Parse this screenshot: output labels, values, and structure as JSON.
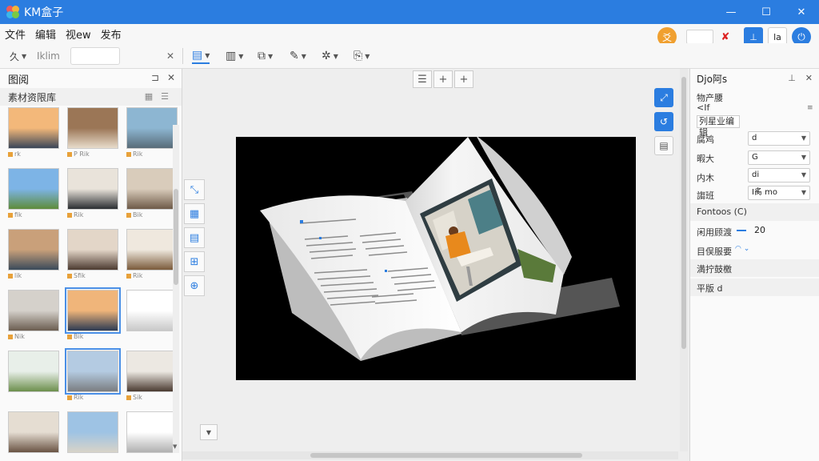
{
  "app": {
    "title": "KM盒子",
    "window_controls": [
      "—",
      "☐",
      "✕"
    ],
    "logo_colors": [
      "#f05a5a",
      "#f2b43a",
      "#3ab6ea",
      "#7ac943"
    ]
  },
  "menu": {
    "items": [
      "文件",
      "编辑",
      "视ew",
      "发布"
    ],
    "right": {
      "orange_btn": "爻",
      "input_value": "",
      "red_x": "✘",
      "blue_btn": "⊥",
      "la_btn": "la",
      "power_btn": "⏻"
    }
  },
  "toolbar": {
    "undo_label": "久",
    "klim_label": "Iklim",
    "field_value": "",
    "close_x": "✕",
    "groups": [
      {
        "icon": "page-icon",
        "glyph": "▤"
      },
      {
        "icon": "doc-icon",
        "glyph": "▥"
      },
      {
        "icon": "frame-icon",
        "glyph": "⧉"
      },
      {
        "icon": "edit-icon",
        "glyph": "✎"
      },
      {
        "icon": "effects-icon",
        "glyph": "✲"
      },
      {
        "icon": "export-icon",
        "glyph": "⎘"
      }
    ]
  },
  "left_panel": {
    "title": "图阅",
    "pin": "⊐",
    "close": "✕",
    "library_title": "素材资限库",
    "thumbs": [
      {
        "label": "rk",
        "style": "sunset"
      },
      {
        "label": "P Rik",
        "style": "interior"
      },
      {
        "label": "Rik",
        "style": "city"
      },
      {
        "label": "fik",
        "style": "field"
      },
      {
        "label": "Rik",
        "style": "tvroom"
      },
      {
        "label": "Bik",
        "style": "room"
      },
      {
        "label": "lik",
        "style": "tablet"
      },
      {
        "label": "Sfik",
        "style": "woman"
      },
      {
        "label": "Rik",
        "style": "cabinet"
      },
      {
        "label": "Nik",
        "style": "office"
      },
      {
        "label": "Bik",
        "style": "dusk"
      },
      {
        "label": "",
        "style": "text"
      },
      {
        "label": "",
        "style": "window"
      },
      {
        "label": "Rik",
        "style": "city2"
      },
      {
        "label": "Sik",
        "style": "person"
      },
      {
        "label": "",
        "style": "desk"
      },
      {
        "label": "",
        "style": "skyline"
      },
      {
        "label": "",
        "style": "paper"
      }
    ]
  },
  "canvas": {
    "top_tools": [
      "☰",
      "+",
      "+"
    ],
    "side_tools": [
      "⤡",
      "▦",
      "▤",
      "⊞",
      "⊕"
    ],
    "right_tools": [
      "⤢",
      "↺",
      "▤"
    ],
    "collapse": "▼"
  },
  "right_panel": {
    "title": "Djo阿s",
    "pin": "⊥",
    "close": "✕",
    "section1": "物产腰",
    "row1": "<If",
    "section2": "列星业编辑",
    "props": [
      {
        "label": "腐鸡",
        "value": "d"
      },
      {
        "label": "暇大",
        "value": "G"
      },
      {
        "label": "内木",
        "value": "di"
      },
      {
        "label": "謅班",
        "value": "I䏑 mo"
      }
    ],
    "fontsize_label": "Fontoos (C)",
    "slider_label": "闲用顾渡",
    "slider_value": "20",
    "opt1_label": "目俣服要",
    "opt2_label": "満拧鼓檄",
    "opt3_label": "平版 d"
  }
}
